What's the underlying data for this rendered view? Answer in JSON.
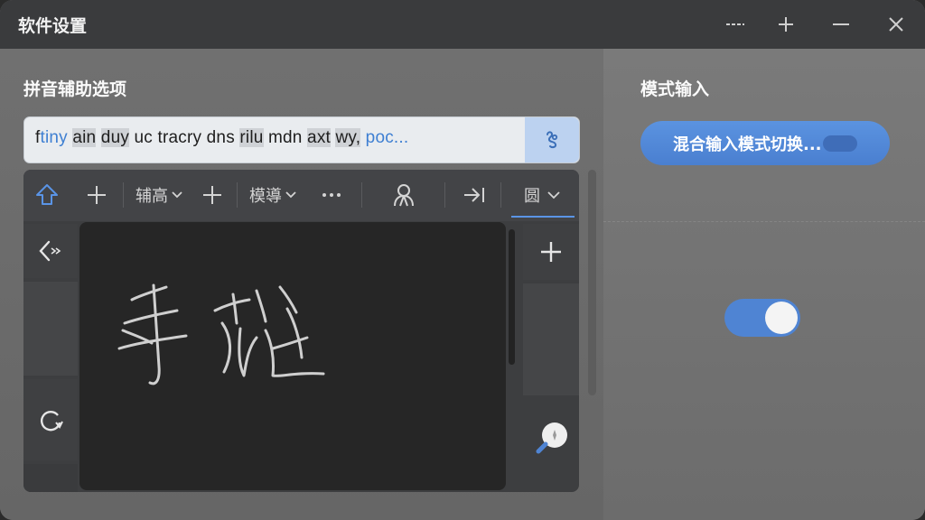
{
  "window": {
    "title": "软件设置"
  },
  "title_buttons": [
    "dash-icon",
    "plus-icon",
    "minimize-icon",
    "close-icon"
  ],
  "pinyin_section": {
    "title": "拼音辅助选项"
  },
  "pinyin_bar": {
    "segments": [
      {
        "text": "f",
        "style": "normal"
      },
      {
        "text": "tiny",
        "style": "blue"
      },
      {
        "text": " ",
        "style": "normal"
      },
      {
        "text": "ain",
        "style": "hl"
      },
      {
        "text": " ",
        "style": "normal"
      },
      {
        "text": "duy",
        "style": "hl"
      },
      {
        "text": " ",
        "style": "normal"
      },
      {
        "text": "uc",
        "style": "normal"
      },
      {
        "text": " ",
        "style": "normal"
      },
      {
        "text": "tracry",
        "style": "normal"
      },
      {
        "text": " ",
        "style": "normal"
      },
      {
        "text": "dns",
        "style": "normal"
      },
      {
        "text": " ",
        "style": "normal"
      },
      {
        "text": "rilu",
        "style": "hl"
      },
      {
        "text": " ",
        "style": "normal"
      },
      {
        "text": "mdn",
        "style": "normal"
      },
      {
        "text": " ",
        "style": "normal"
      },
      {
        "text": "axt",
        "style": "hl"
      },
      {
        "text": " ",
        "style": "normal"
      },
      {
        "text": "wy,",
        "style": "hl"
      },
      {
        "text": " ",
        "style": "normal"
      },
      {
        "text": "poc...",
        "style": "blue"
      }
    ],
    "button_icon": "voice-icon"
  },
  "keyboard_toolbar": {
    "items": [
      {
        "name": "shift-icon"
      },
      {
        "name": "plus-icon"
      },
      {
        "label": "辅高"
      },
      {
        "name": "plus-icon"
      },
      {
        "label": "模導"
      },
      {
        "name": "more-icon"
      },
      {
        "name": "user-icon"
      },
      {
        "name": "arrow-right-icon"
      },
      {
        "label": "圆"
      }
    ]
  },
  "handwriting": {
    "strokes_text": "手花"
  },
  "mode_section": {
    "title": "模式输入",
    "button_label": "混合输入模式切换..."
  },
  "toggle": {
    "on": true
  },
  "colors": {
    "accent": "#4f84d3",
    "titlebar": "#3a3b3d",
    "pad": "#262626"
  }
}
